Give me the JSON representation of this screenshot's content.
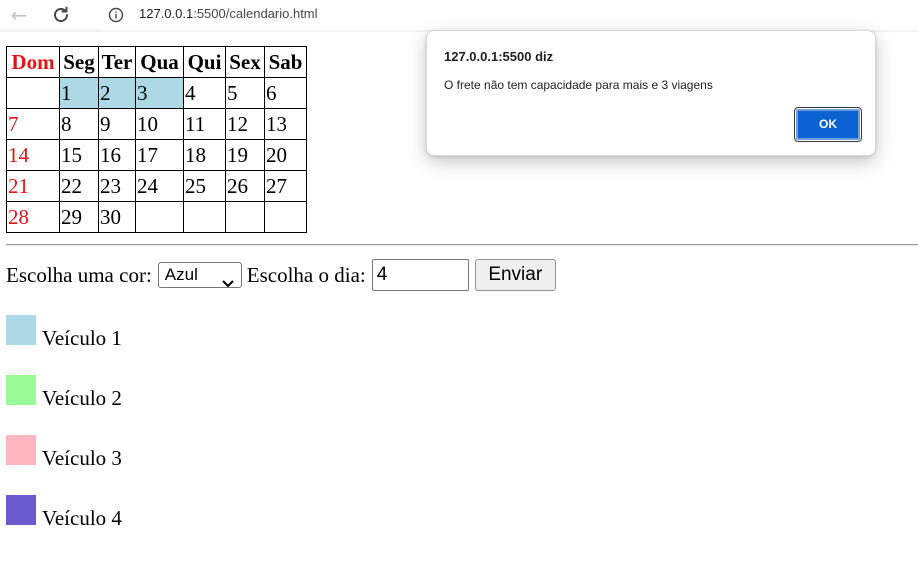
{
  "browser": {
    "url_host": "127.0.0.1",
    "url_path": ":5500/calendario.html"
  },
  "calendar": {
    "headers": [
      "Dom",
      "Seg",
      "Ter",
      "Qua",
      "Qui",
      "Sex",
      "Sab"
    ],
    "rows": [
      [
        "",
        "1",
        "2",
        "3",
        "4",
        "5",
        "6"
      ],
      [
        "7",
        "8",
        "9",
        "10",
        "11",
        "12",
        "13"
      ],
      [
        "14",
        "15",
        "16",
        "17",
        "18",
        "19",
        "20"
      ],
      [
        "21",
        "22",
        "23",
        "24",
        "25",
        "26",
        "27"
      ],
      [
        "28",
        "29",
        "30",
        "",
        "",
        "",
        ""
      ]
    ],
    "highlight_color": "#add8e6",
    "sunday_color": "#e01515"
  },
  "form": {
    "color_label": "Escolha uma cor:",
    "color_value": "Azul",
    "day_label": "Escolha o dia:",
    "day_value": "4",
    "submit_label": "Enviar"
  },
  "vehicles": [
    {
      "label": "Veículo 1",
      "color": "#add8e6"
    },
    {
      "label": "Veículo 2",
      "color": "#98fb98"
    },
    {
      "label": "Veículo 3",
      "color": "#ffb6c1"
    },
    {
      "label": "Veículo 4",
      "color": "#6a5acd"
    }
  ],
  "alert": {
    "title": "127.0.0.1:5500 diz",
    "message": "O frete não tem capacidade para mais e 3 viagens",
    "ok_label": "OK"
  }
}
